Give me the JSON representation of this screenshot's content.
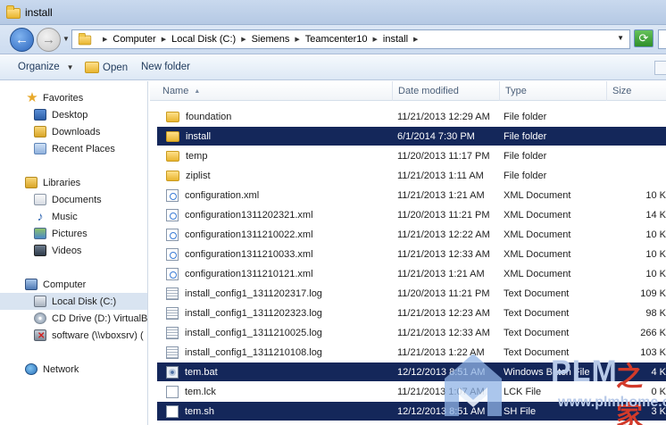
{
  "window": {
    "title": "install"
  },
  "address": {
    "crumbs": [
      "Computer",
      "Local Disk (C:)",
      "Siemens",
      "Teamcenter10",
      "install"
    ]
  },
  "toolbar": {
    "organize": "Organize",
    "open": "Open",
    "new_folder": "New folder"
  },
  "nav": {
    "favorites": {
      "label": "Favorites",
      "items": [
        "Desktop",
        "Downloads",
        "Recent Places"
      ]
    },
    "libraries": {
      "label": "Libraries",
      "items": [
        "Documents",
        "Music",
        "Pictures",
        "Videos"
      ]
    },
    "computer": {
      "label": "Computer",
      "items": [
        "Local Disk (C:)",
        "CD Drive (D:) VirtualBo",
        "software (\\\\vboxsrv) ("
      ]
    },
    "network": {
      "label": "Network"
    }
  },
  "columns": {
    "name": "Name",
    "date": "Date modified",
    "type": "Type",
    "size": "Size"
  },
  "files": [
    {
      "name": "foundation",
      "date": "11/21/2013 12:29 AM",
      "type": "File folder",
      "size": "",
      "icon": "folder"
    },
    {
      "name": "install",
      "date": "6/1/2014 7:30 PM",
      "type": "File folder",
      "size": "",
      "icon": "folder"
    },
    {
      "name": "temp",
      "date": "11/20/2013 11:17 PM",
      "type": "File folder",
      "size": "",
      "icon": "folder"
    },
    {
      "name": "ziplist",
      "date": "11/21/2013 1:11 AM",
      "type": "File folder",
      "size": "",
      "icon": "folder"
    },
    {
      "name": "configuration.xml",
      "date": "11/21/2013 1:21 AM",
      "type": "XML Document",
      "size": "10 K",
      "icon": "xml"
    },
    {
      "name": "configuration1311202321.xml",
      "date": "11/20/2013 11:21 PM",
      "type": "XML Document",
      "size": "14 K",
      "icon": "xml"
    },
    {
      "name": "configuration1311210022.xml",
      "date": "11/21/2013 12:22 AM",
      "type": "XML Document",
      "size": "10 K",
      "icon": "xml"
    },
    {
      "name": "configuration1311210033.xml",
      "date": "11/21/2013 12:33 AM",
      "type": "XML Document",
      "size": "10 K",
      "icon": "xml"
    },
    {
      "name": "configuration1311210121.xml",
      "date": "11/21/2013 1:21 AM",
      "type": "XML Document",
      "size": "10 K",
      "icon": "xml"
    },
    {
      "name": "install_config1_1311202317.log",
      "date": "11/20/2013 11:21 PM",
      "type": "Text Document",
      "size": "109 K",
      "icon": "txt"
    },
    {
      "name": "install_config1_1311202323.log",
      "date": "11/21/2013 12:23 AM",
      "type": "Text Document",
      "size": "98 K",
      "icon": "txt"
    },
    {
      "name": "install_config1_1311210025.log",
      "date": "11/21/2013 12:33 AM",
      "type": "Text Document",
      "size": "266 K",
      "icon": "txt"
    },
    {
      "name": "install_config1_1311210108.log",
      "date": "11/21/2013 1:22 AM",
      "type": "Text Document",
      "size": "103 K",
      "icon": "txt"
    },
    {
      "name": "tem.bat",
      "date": "12/12/2013 8:51 AM",
      "type": "Windows Batch File",
      "size": "4 K",
      "icon": "bat"
    },
    {
      "name": "tem.lck",
      "date": "11/21/2013 1:07 AM",
      "type": "LCK File",
      "size": "0 K",
      "icon": "blank"
    },
    {
      "name": "tem.sh",
      "date": "12/12/2013 8:51 AM",
      "type": "SH File",
      "size": "3 K",
      "icon": "blank"
    }
  ],
  "selected_rows": [
    1,
    13,
    15
  ],
  "watermark": {
    "brand": "PLM",
    "cn": "之家",
    "url": "www.plmhome.com"
  },
  "colors": {
    "selection": "#14275a",
    "accent": "#3369b3"
  }
}
